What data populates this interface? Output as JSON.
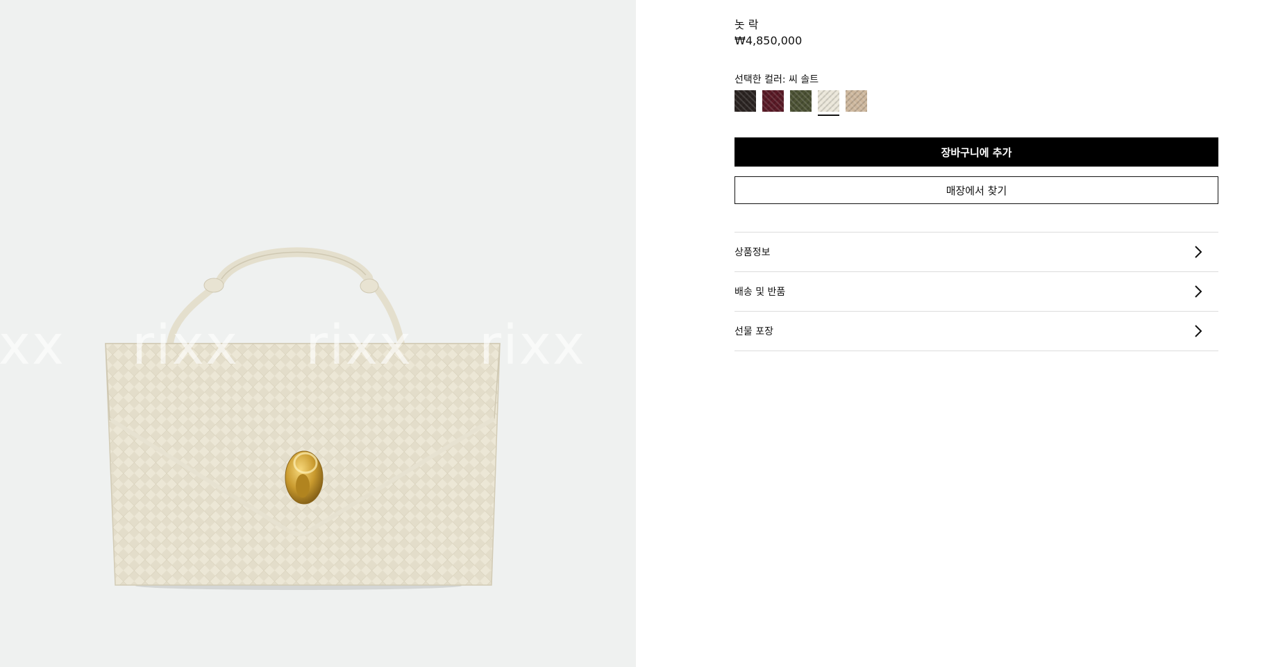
{
  "gallery": {
    "watermark_text": "rixx"
  },
  "product": {
    "name": "놋 락",
    "price": "₩4,850,000"
  },
  "color_selector": {
    "label": "선택한 컬러: 씨 솔트",
    "swatches": [
      {
        "color": "#2b2422",
        "selected": false
      },
      {
        "color": "#5a1a26",
        "selected": false
      },
      {
        "color": "#4c5234",
        "selected": false
      },
      {
        "color": "#eae6d9",
        "selected": true
      },
      {
        "color": "#cdb79d",
        "selected": false
      }
    ]
  },
  "actions": {
    "add_to_cart": "장바구니에 추가",
    "find_in_store": "매장에서 찾기"
  },
  "accordion": {
    "items": [
      {
        "label": "상품정보",
        "icon": "chevron-right-icon"
      },
      {
        "label": "배송 및 반품",
        "icon": "chevron-right-icon"
      },
      {
        "label": "선물 포장",
        "icon": "chevron-right-icon"
      }
    ]
  },
  "colors": {
    "image_bg": "#eff1f0",
    "primary_button_bg": "#000000",
    "primary_button_text": "#ffffff"
  }
}
